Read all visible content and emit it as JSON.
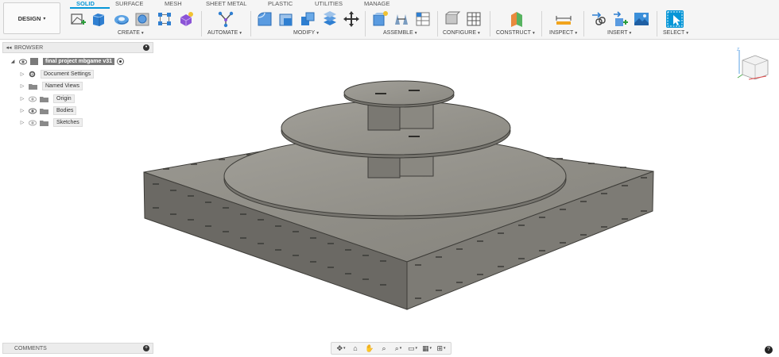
{
  "workspace": {
    "label": "DESIGN"
  },
  "tabs": [
    "SOLID",
    "SURFACE",
    "MESH",
    "SHEET METAL",
    "PLASTIC",
    "UTILITIES",
    "MANAGE"
  ],
  "groups": {
    "create": "CREATE",
    "automate": "AUTOMATE",
    "modify": "MODIFY",
    "assemble": "ASSEMBLE",
    "configure": "CONFIGURE",
    "construct": "CONSTRUCT",
    "inspect": "INSPECT",
    "insert": "INSERT",
    "select": "SELECT"
  },
  "browser": {
    "title": "BROWSER",
    "root": "final project mbgame v31",
    "items": [
      "Document Settings",
      "Named Views",
      "Origin",
      "Bodies",
      "Sketches"
    ]
  },
  "comments": {
    "title": "COMMENTS"
  },
  "colors": {
    "accent": "#0696d7",
    "model_face": "#8f8d86",
    "model_side": "#6e6c66"
  }
}
